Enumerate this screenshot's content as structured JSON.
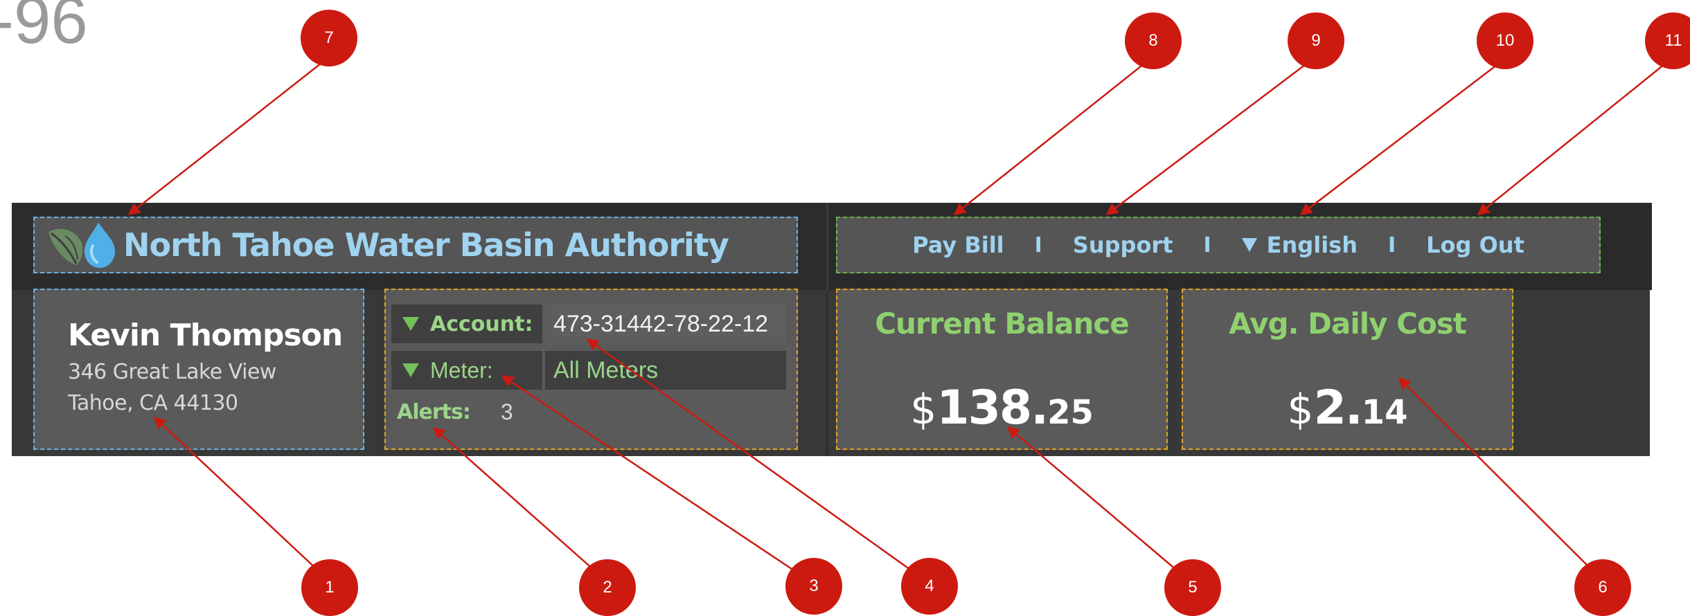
{
  "corner_label": "-96",
  "header": {
    "brand_name": "North Tahoe Water Basin Authority",
    "nav": [
      {
        "label": "Pay Bill"
      },
      {
        "label": "Support"
      },
      {
        "label": "English"
      },
      {
        "label": "Log Out"
      }
    ],
    "separator": "I"
  },
  "customer": {
    "name": "Kevin Thompson",
    "address_line1": "346 Great Lake View",
    "address_line2": "Tahoe, CA 44130"
  },
  "account_panel": {
    "account_label": "Account:",
    "account_value": "473-31442-78-22-12",
    "meter_label": "Meter:",
    "meter_value": "All Meters",
    "alerts_label": "Alerts:",
    "alerts_count": "3"
  },
  "metrics": {
    "current_balance": {
      "title": "Current Balance",
      "currency": "$",
      "whole": "138.",
      "cents": "25"
    },
    "avg_daily_cost": {
      "title": "Avg. Daily Cost",
      "currency": "$",
      "whole": "2.",
      "cents": "14"
    }
  },
  "annotation_markers": [
    "1",
    "2",
    "3",
    "4",
    "5",
    "6",
    "7",
    "8",
    "9",
    "10",
    "11"
  ],
  "colors": {
    "marker_red": "#cc1a10",
    "accent_blue": "#9fd3f0",
    "accent_green": "#8fd16f",
    "panel_gray": "#5a5a5a",
    "header_dark": "#2c2c2c"
  },
  "icons": {
    "logo": "leaf-water-drop-icon",
    "dropdown": "caret-down-icon"
  }
}
